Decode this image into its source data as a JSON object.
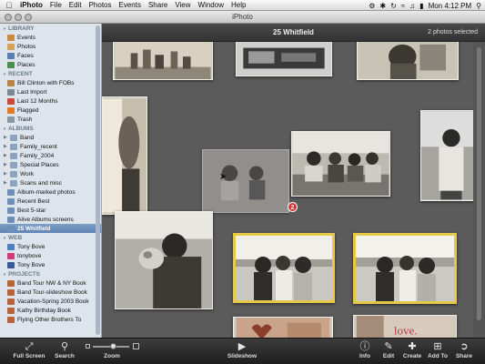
{
  "menubar": {
    "app": "iPhoto",
    "items": [
      "File",
      "Edit",
      "Photos",
      "Events",
      "Share",
      "View",
      "Window",
      "Help"
    ],
    "clock": "Mon 4:12 PM"
  },
  "window": {
    "title": "iPhoto"
  },
  "sidebar": {
    "library_header": "LIBRARY",
    "library": [
      {
        "label": "Events",
        "icon": "events-icon",
        "color": "#c98a3b"
      },
      {
        "label": "Photos",
        "icon": "photos-icon",
        "color": "#d7a257"
      },
      {
        "label": "Faces",
        "icon": "faces-icon",
        "color": "#5b7fb0"
      },
      {
        "label": "Places",
        "icon": "places-icon",
        "color": "#4b8f4f"
      }
    ],
    "recent_header": "RECENT",
    "recent": [
      {
        "label": "Bill Clinton with FOBs",
        "icon": "event-icon",
        "color": "#b98545"
      },
      {
        "label": "Last Import",
        "icon": "import-icon",
        "color": "#7a8894"
      },
      {
        "label": "Last 12 Months",
        "icon": "calendar-icon",
        "color": "#c94a3b"
      },
      {
        "label": "Flagged",
        "icon": "flag-icon",
        "color": "#e07a24"
      },
      {
        "label": "Trash",
        "icon": "trash-icon",
        "color": "#8a96a2"
      }
    ],
    "albums_header": "ALBUMS",
    "albums": [
      {
        "label": "Band",
        "folder": true
      },
      {
        "label": "Family_recent",
        "folder": true
      },
      {
        "label": "Family_2004",
        "folder": true
      },
      {
        "label": "Special Places",
        "folder": true
      },
      {
        "label": "Work",
        "folder": true
      },
      {
        "label": "Scans and misc",
        "folder": true
      },
      {
        "label": "Album-marked photos",
        "folder": false
      },
      {
        "label": "Recent Best",
        "folder": false
      },
      {
        "label": "Best 5-star",
        "folder": false
      },
      {
        "label": "Alive Albums screens",
        "folder": false
      },
      {
        "label": "25 Whitfield",
        "folder": false,
        "selected": true
      }
    ],
    "web_header": "WEB",
    "web": [
      {
        "label": "Tony Bove",
        "icon": "mobileme-icon",
        "color": "#4d7fc0"
      },
      {
        "label": "tonybove",
        "icon": "flickr-icon",
        "color": "#d23b7a"
      },
      {
        "label": "Tony Bove",
        "icon": "facebook-icon",
        "color": "#3b5998"
      }
    ],
    "projects_header": "PROJECTS",
    "projects": [
      {
        "label": "Band Tour NW & NY Book"
      },
      {
        "label": "Band Tour-slideshow Book"
      },
      {
        "label": "Vacation-Spring 2003 Book"
      },
      {
        "label": "Kathy Birthday Book"
      },
      {
        "label": "Flying Other Brothers To"
      }
    ]
  },
  "header": {
    "album_title": "25 Whitfield",
    "selection": "2 photos selected"
  },
  "drag": {
    "count": "2"
  },
  "toolbar": {
    "full_screen": "Full Screen",
    "search": "Search",
    "zoom": "Zoom",
    "zoom_level": 0.55,
    "slideshow": "Slideshow",
    "info": "Info",
    "edit": "Edit",
    "create": "Create",
    "add_to": "Add To",
    "share": "Share"
  },
  "colors": {
    "selection_border": "#e7c94a",
    "sidebar_selected": "#5f84b5"
  }
}
